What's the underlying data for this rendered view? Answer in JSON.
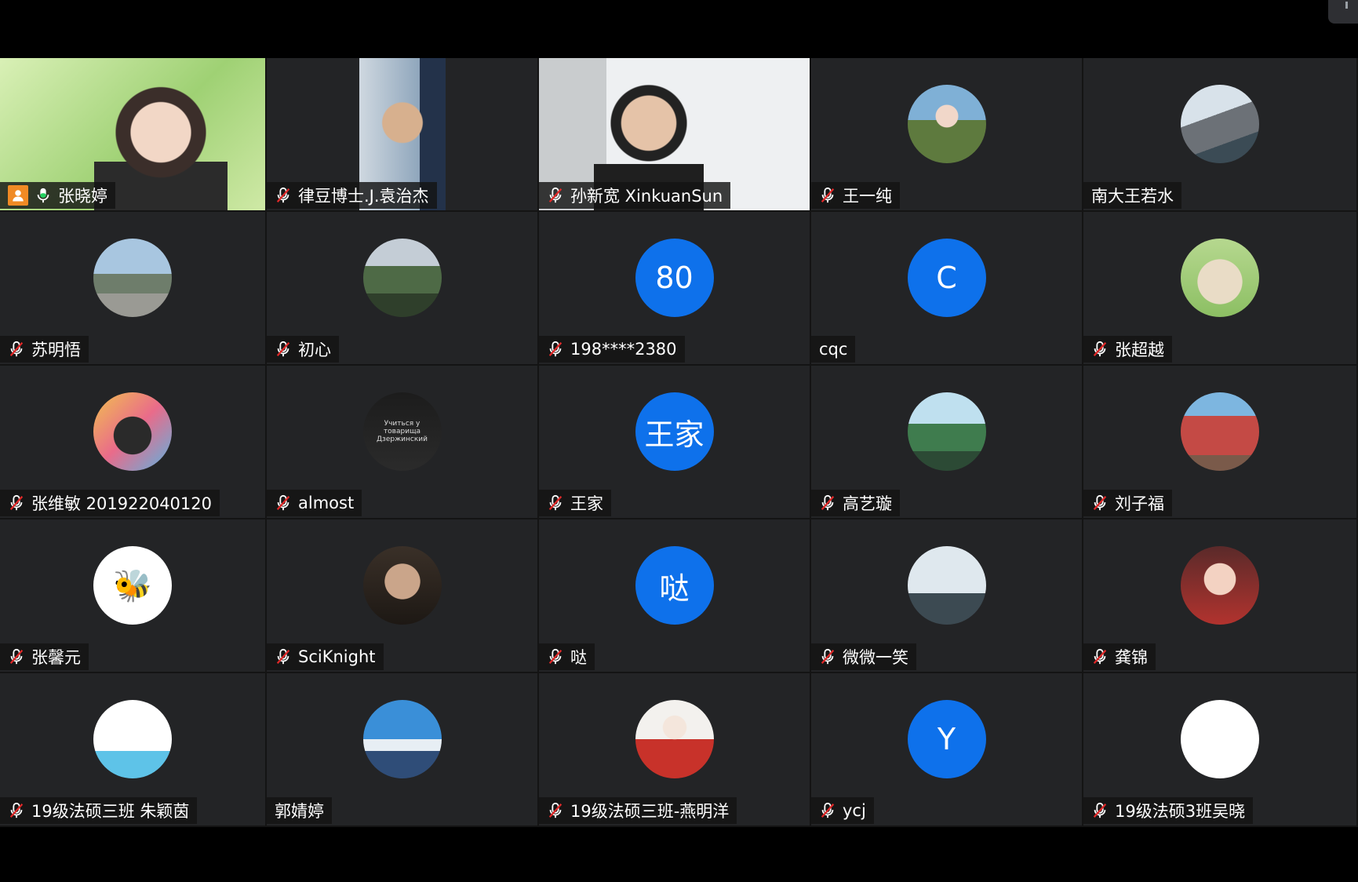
{
  "participants": [
    {
      "name": "张晓婷",
      "mic": "on",
      "kind": "video",
      "host": true,
      "icon": "person-video"
    },
    {
      "name": "律豆博士.J.袁治杰",
      "mic": "muted",
      "kind": "video",
      "icon": "person-video"
    },
    {
      "name": "孙新宽 XinkuanSun",
      "mic": "muted",
      "kind": "video",
      "icon": "person-video"
    },
    {
      "name": "王一纯",
      "mic": "muted",
      "kind": "photo",
      "icon": "girl-photo"
    },
    {
      "name": "南大王若水",
      "mic": "none",
      "kind": "photo",
      "icon": "town-photo"
    },
    {
      "name": "苏明悟",
      "mic": "muted",
      "kind": "photo",
      "icon": "street-photo"
    },
    {
      "name": "初心",
      "mic": "muted",
      "kind": "photo",
      "icon": "landscape-photo"
    },
    {
      "name": "198****2380",
      "mic": "muted",
      "kind": "letter",
      "initial": "80"
    },
    {
      "name": "cqc",
      "mic": "none",
      "kind": "letter",
      "initial": "C"
    },
    {
      "name": "张超越",
      "mic": "muted",
      "kind": "photo",
      "icon": "cat-photo"
    },
    {
      "name": "张维敏 201922040120",
      "mic": "muted",
      "kind": "photo",
      "icon": "dog-photo"
    },
    {
      "name": "almost",
      "mic": "muted",
      "kind": "photo",
      "icon": "poster-photo",
      "caption": "Учиться у товарища Дзержинский"
    },
    {
      "name": "王家",
      "mic": "muted",
      "kind": "letter",
      "initial": "王家"
    },
    {
      "name": "高艺璇",
      "mic": "muted",
      "kind": "photo",
      "icon": "park-photo"
    },
    {
      "name": "刘子福",
      "mic": "muted",
      "kind": "photo",
      "icon": "wall-photo"
    },
    {
      "name": "张馨元",
      "mic": "muted",
      "kind": "photo",
      "icon": "bee-drawing"
    },
    {
      "name": "SciKnight",
      "mic": "muted",
      "kind": "photo",
      "icon": "man-portrait"
    },
    {
      "name": "哒",
      "mic": "muted",
      "kind": "letter",
      "initial": "哒"
    },
    {
      "name": "微微一笑",
      "mic": "muted",
      "kind": "photo",
      "icon": "sky-photo"
    },
    {
      "name": "龚锦",
      "mic": "muted",
      "kind": "photo",
      "icon": "woman-portrait"
    },
    {
      "name": "19级法硕三班 朱颖茵",
      "mic": "muted",
      "kind": "photo",
      "icon": "doodle-drawing"
    },
    {
      "name": "郭婧婷",
      "mic": "none",
      "kind": "photo",
      "icon": "mountain-photo"
    },
    {
      "name": "19级法硕三班-燕明洋",
      "mic": "muted",
      "kind": "photo",
      "icon": "illustration-portrait"
    },
    {
      "name": "ycj",
      "mic": "muted",
      "kind": "letter",
      "initial": "Y"
    },
    {
      "name": "19级法硕3班吴晓",
      "mic": "muted",
      "kind": "photo",
      "icon": "rainbow-apple-logo"
    }
  ],
  "colors": {
    "tile_bg": "#232426",
    "avatar_blue": "#0e71eb",
    "muted_red": "#e02828",
    "mic_green": "#23d160",
    "host_orange": "#f08a24"
  }
}
